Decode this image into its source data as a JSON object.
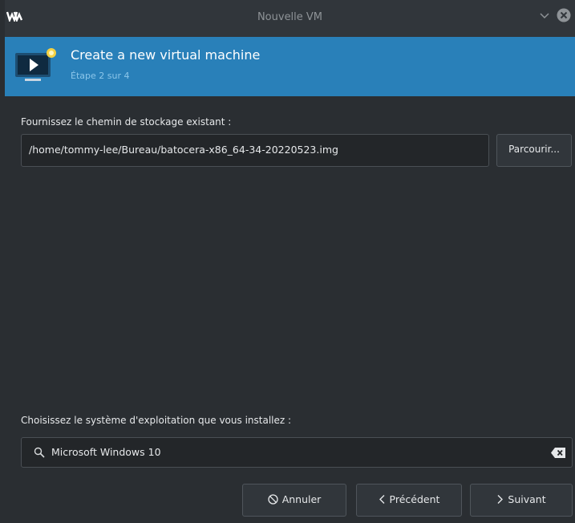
{
  "window": {
    "title": "Nouvelle VM",
    "app_icon": "vm-logo-icon",
    "controls": [
      "chevron-down-icon",
      "close-icon"
    ]
  },
  "banner": {
    "heading": "Create a new virtual machine",
    "step": "Étape 2 sur 4",
    "icon": "monitor-play-icon",
    "color": "#2980b9"
  },
  "storage": {
    "label": "Fournissez le chemin de stockage existant :",
    "path_value": "/home/tommy-lee/Bureau/batocera-x86_64-34-20220523.img",
    "browse_label": "Parcourir..."
  },
  "os": {
    "label": "Choisissez le système d'exploitation que vous installez :",
    "value": "Microsoft Windows 10",
    "search_icon": "search-icon",
    "clear_icon": "clear-text-icon"
  },
  "footer": {
    "cancel_label": "Annuler",
    "prev_label": "Précédent",
    "next_label": "Suivant"
  }
}
